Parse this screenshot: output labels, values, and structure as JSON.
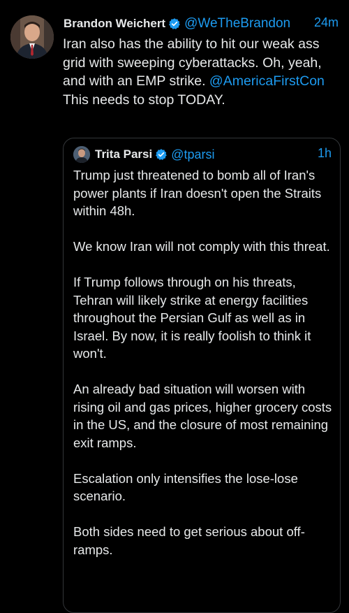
{
  "tweet": {
    "author_name": "Brandon Weichert",
    "author_handle": "@WeTheBrandon",
    "time": "24m",
    "text_part1": "Iran also has the ability to hit our weak ass grid with sweeping cyberattacks. Oh, yeah, and with an EMP strike.",
    "mention": "@AmericaFirstCon",
    "text_part2": "This needs to stop TODAY."
  },
  "quote": {
    "author_name": "Trita Parsi",
    "author_handle": "@tparsi",
    "time": "1h",
    "paragraphs": [
      "Trump just threatened to bomb all of Iran's power plants if Iran doesn't open the Straits within 48h.",
      "We know Iran will not comply with this threat.",
      "If Trump follows through on his threats, Tehran will likely strike at energy facilities throughout the Persian Gulf as well as in Israel. By now, it is really foolish to think it won't.",
      "An already bad situation will worsen with rising oil and gas prices, higher grocery costs in the US, and the closure of most remaining exit ramps.",
      "Escalation only intensifies the lose-lose scenario.",
      "Both sides need to get serious about off-ramps."
    ]
  },
  "colors": {
    "background": "#000000",
    "text": "#e7e9ea",
    "accent": "#1d9bf0",
    "border": "#333639"
  },
  "icons": [
    "verified-badge-icon"
  ]
}
